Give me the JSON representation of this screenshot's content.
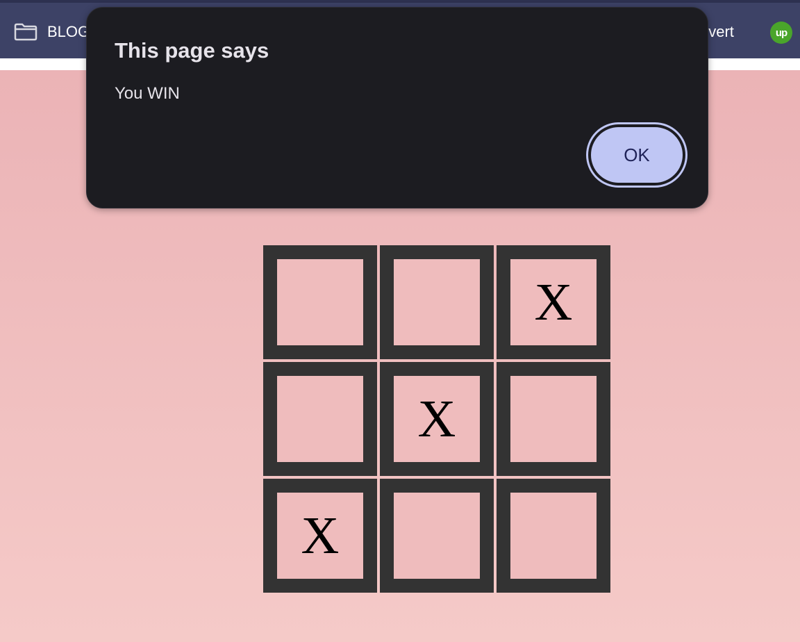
{
  "browser": {
    "bookmarks": [
      {
        "label": "BLOG",
        "icon": "folder-icon"
      },
      {
        "label": "nvert"
      }
    ],
    "extension_icon": {
      "name": "upwork-icon",
      "text": "up",
      "color": "#4aa52b"
    }
  },
  "dialog": {
    "title": "This page says",
    "message": "You WIN",
    "ok_label": "OK"
  },
  "board": {
    "cells": [
      "",
      "",
      "X",
      "",
      "X",
      "",
      "X",
      "",
      ""
    ]
  },
  "colors": {
    "bookmarks_bar": "#3d4266",
    "dialog_bg": "#1c1c21",
    "ok_button": "#bfc6f4",
    "cell_border": "#333333",
    "page_top": "#ebb3b6",
    "page_bottom": "#f5cac8"
  }
}
